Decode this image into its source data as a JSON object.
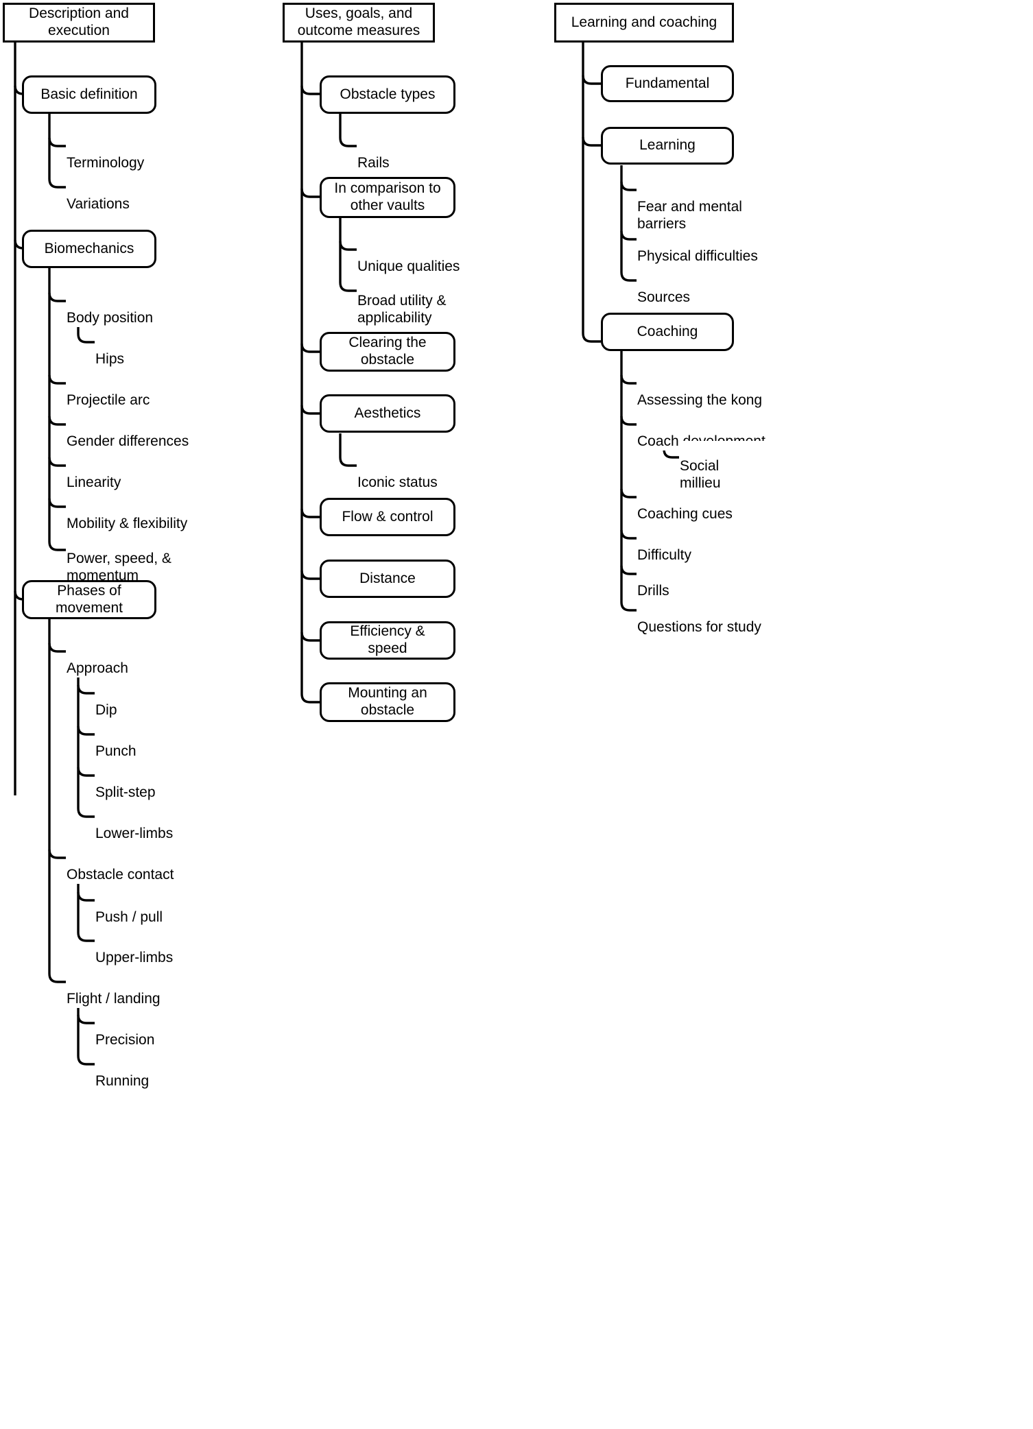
{
  "diagram": {
    "type": "mind-map-tree",
    "title_visible": false,
    "columns": [
      {
        "id": "col-1",
        "root": {
          "label": "Description and\nexecution"
        },
        "branches": [
          {
            "label": "Basic definition",
            "children": [
              {
                "label": "Terminology"
              },
              {
                "label": "Variations"
              }
            ]
          },
          {
            "label": "Biomechanics",
            "children": [
              {
                "label": "Body position",
                "children": [
                  {
                    "label": "Hips"
                  }
                ]
              },
              {
                "label": "Projectile arc"
              },
              {
                "label": "Gender differences"
              },
              {
                "label": "Linearity"
              },
              {
                "label": "Mobility & flexibility"
              },
              {
                "label": "Power, speed, &\nmomentum"
              }
            ]
          },
          {
            "label": "Phases of\nmovement",
            "children": [
              {
                "label": "Approach",
                "children": [
                  {
                    "label": "Dip"
                  },
                  {
                    "label": "Punch"
                  },
                  {
                    "label": "Split-step"
                  },
                  {
                    "label": "Lower-limbs"
                  }
                ]
              },
              {
                "label": "Obstacle contact",
                "children": [
                  {
                    "label": "Push / pull"
                  },
                  {
                    "label": "Upper-limbs"
                  }
                ]
              },
              {
                "label": "Flight / landing",
                "children": [
                  {
                    "label": "Precision"
                  },
                  {
                    "label": "Running"
                  }
                ]
              }
            ]
          }
        ]
      },
      {
        "id": "col-2",
        "root": {
          "label": "Uses, goals, and\noutcome measures"
        },
        "branches": [
          {
            "label": "Obstacle types",
            "children": [
              {
                "label": "Rails"
              }
            ]
          },
          {
            "label": "In comparison to\nother vaults",
            "children": [
              {
                "label": "Unique qualities"
              },
              {
                "label": "Broad utility &\napplicability"
              }
            ]
          },
          {
            "label": "Clearing the\nobstacle",
            "children": []
          },
          {
            "label": "Aesthetics",
            "children": [
              {
                "label": "Iconic status"
              }
            ]
          },
          {
            "label": "Flow & control",
            "children": []
          },
          {
            "label": "Distance",
            "children": []
          },
          {
            "label": "Efficiency & speed",
            "children": []
          },
          {
            "label": "Mounting an\nobstacle",
            "children": []
          }
        ]
      },
      {
        "id": "col-3",
        "root": {
          "label": "Learning and coaching"
        },
        "branches": [
          {
            "label": "Fundamental",
            "children": []
          },
          {
            "label": "Learning",
            "children": [
              {
                "label": "Fear and mental\nbarriers"
              },
              {
                "label": "Physical difficulties"
              },
              {
                "label": "Sources"
              }
            ]
          },
          {
            "label": "Coaching",
            "children": [
              {
                "label": "Assessing the kong"
              },
              {
                "label": "Coach development",
                "children": [
                  {
                    "label": "Social\nmillieu"
                  }
                ]
              },
              {
                "label": "Coaching cues"
              },
              {
                "label": "Difficulty"
              },
              {
                "label": "Drills"
              },
              {
                "label": "Questions for study"
              }
            ]
          }
        ]
      }
    ]
  },
  "style": {
    "line_color": "#000000",
    "text_color": "#000000",
    "background": "#ffffff"
  }
}
